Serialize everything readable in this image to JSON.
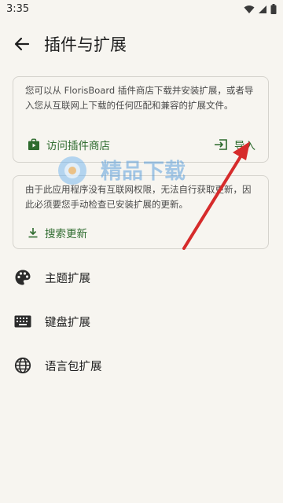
{
  "status_bar": {
    "time": "3:35"
  },
  "header": {
    "title": "插件与扩展"
  },
  "store_card": {
    "description": "您可以从 FlorisBoard 插件商店下载并安装扩展，或者导入您从互联网上下载的任何匹配和兼容的扩展文件。",
    "visit_store_label": "访问插件商店",
    "import_label": "导入"
  },
  "update_card": {
    "description": "由于此应用程序没有互联网权限，无法自行获取更新，因此必须要您手动检查已安装扩展的更新。",
    "search_updates_label": "搜索更新"
  },
  "list": {
    "items": [
      {
        "label": "主题扩展",
        "icon": "palette-icon"
      },
      {
        "label": "键盘扩展",
        "icon": "keyboard-icon"
      },
      {
        "label": "语言包扩展",
        "icon": "globe-icon"
      }
    ]
  },
  "watermark": {
    "text": "精品下载"
  },
  "colors": {
    "background": "#f7f5f0",
    "accent": "#2e6b2e",
    "annotation_arrow": "#d62b2b"
  }
}
